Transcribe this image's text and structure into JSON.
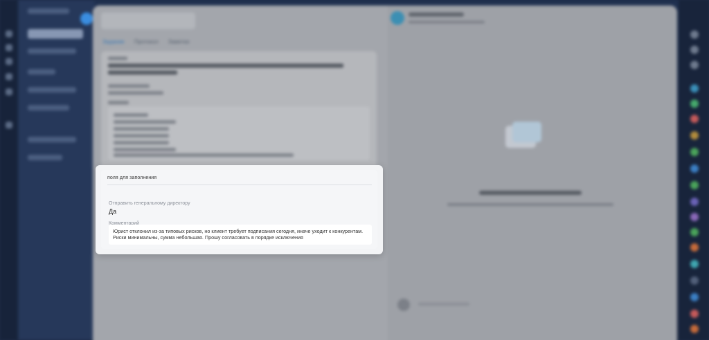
{
  "popup": {
    "title": "поля для заполнения",
    "fields": [
      {
        "label": "Отправить генеральному директору",
        "value": "Да"
      },
      {
        "label": "Комментарий",
        "value": "Юрист отклонил из-за типовых рисков, но клиент требует подписания сегодня, иначе уходит к конкурентам. Риски минимальны, сумма небольшая. Прошу согласовать в порядке исключения"
      }
    ]
  },
  "background": {
    "tabs": [
      "Задание",
      "Протокол",
      "Заметки"
    ]
  },
  "colors": {
    "accent": "#3a8de0",
    "popup_bg": "#f3f4f6",
    "overlay": "#9c9fa6"
  }
}
